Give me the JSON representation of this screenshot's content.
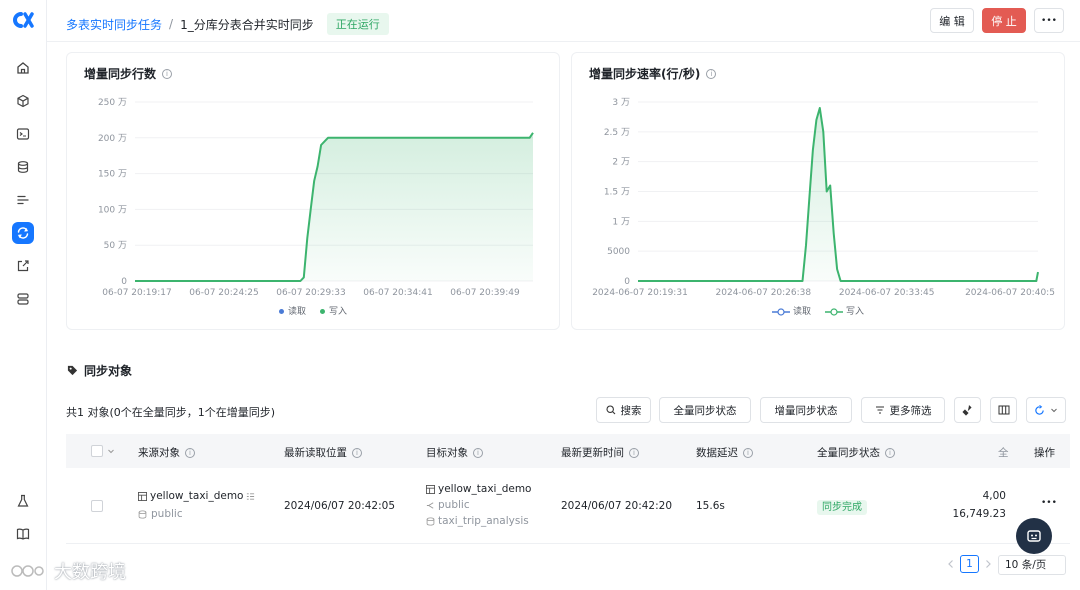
{
  "breadcrumb": {
    "parent": "多表实时同步任务",
    "separator": "/",
    "current": "1_分库分表合并实时同步",
    "status": "正在运行"
  },
  "header_buttons": {
    "edit": "编 辑",
    "stop": "停 止",
    "more": "•••"
  },
  "sidebar": {
    "items": [
      "home-icon",
      "cube-icon",
      "terminal-icon",
      "database-icon",
      "list-icon",
      "sync-icon",
      "export-icon",
      "server-icon",
      "flask-icon",
      "book-icon"
    ],
    "active_index": 5
  },
  "chart_data": [
    {
      "type": "area",
      "title": "增量同步行数",
      "ylim": [
        0,
        2500000
      ],
      "y_ticks": [
        "250 万",
        "200 万",
        "150 万",
        "100 万",
        "50 万",
        "0"
      ],
      "x_ticks": [
        "06-07 20:19:17",
        "06-07 20:24:25",
        "06-07 20:29:33",
        "06-07 20:34:41",
        "06-07 20:39:49"
      ],
      "legend": [
        "读取",
        "写入"
      ],
      "series": [
        {
          "name": "写入",
          "x_minutes": [
            0,
            9.6,
            9.8,
            10.0,
            10.2,
            10.4,
            10.6,
            10.8,
            11.0,
            11.2,
            11.4,
            22.9,
            23.1
          ],
          "values": [
            0,
            0,
            50000,
            600000,
            1000000,
            1400000,
            1600000,
            1900000,
            1950000,
            2000000,
            2000000,
            2000000,
            2070000
          ]
        }
      ]
    },
    {
      "type": "area",
      "title": "增量同步速率(行/秒)",
      "ylim": [
        0,
        30000
      ],
      "y_ticks": [
        "3 万",
        "2.5 万",
        "2 万",
        "1.5 万",
        "1 万",
        "5000",
        "0"
      ],
      "x_ticks": [
        "2024-06-07 20:19:31",
        "2024-06-07 20:26:38",
        "2024-06-07 20:33:45",
        "2024-06-07 20:40:5"
      ],
      "legend": [
        "读取",
        "写入"
      ],
      "series": [
        {
          "name": "写入",
          "x_minutes": [
            0,
            9.5,
            9.7,
            9.9,
            10.1,
            10.3,
            10.5,
            10.7,
            10.9,
            11.1,
            11.3,
            11.5,
            11.7,
            23.0,
            23.1
          ],
          "values": [
            0,
            0,
            6000,
            14000,
            22000,
            27000,
            29000,
            25000,
            15000,
            16000,
            8000,
            2000,
            0,
            0,
            1500
          ]
        }
      ]
    }
  ],
  "sync_section": {
    "title": "同步对象",
    "summary": "共1 对象(0个在全量同步，1个在增量同步)",
    "filters": {
      "search": "搜索",
      "full_status": "全量同步状态",
      "incr_status": "增量同步状态",
      "more_filters": "更多筛选"
    },
    "columns": [
      "来源对象",
      "最新读取位置",
      "目标对象",
      "最新更新时间",
      "数据延迟",
      "全量同步状态",
      "全",
      "操作"
    ],
    "row": {
      "source_table": "yellow_taxi_demo",
      "source_schema": "public",
      "read_position": "2024/06/07 20:42:05",
      "target_table": "yellow_taxi_demo",
      "target_schema": "public",
      "target_db": "taxi_trip_analysis",
      "update_time": "2024/06/07 20:42:20",
      "delay": "15.6s",
      "full_status": "同步完成",
      "count_1": "4,00",
      "count_2": "16,749.23",
      "action": "•••"
    }
  },
  "pagination": {
    "current_page": "1",
    "page_size": "10 条/页"
  },
  "watermark": "大数跨境",
  "colors": {
    "accent": "#1677ff",
    "series": "#3cb46e",
    "danger": "#e35b53"
  }
}
